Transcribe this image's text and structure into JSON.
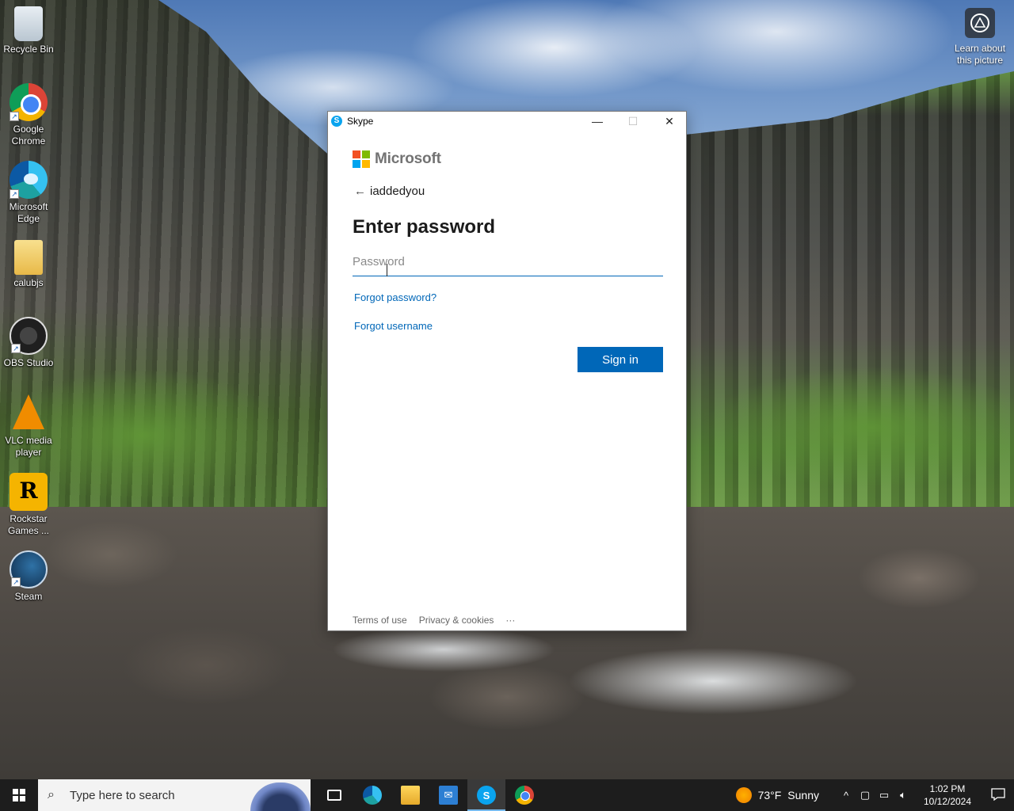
{
  "desktop": {
    "icons": [
      {
        "label": "Recycle Bin",
        "icon": "recycle-bin-icon"
      },
      {
        "label": "Google Chrome",
        "icon": "chrome-icon"
      },
      {
        "label": "Microsoft Edge",
        "icon": "edge-icon"
      },
      {
        "label": "calubjs",
        "icon": "folder-icon"
      },
      {
        "label": "OBS Studio",
        "icon": "obs-icon"
      },
      {
        "label": "VLC media player",
        "icon": "vlc-icon"
      },
      {
        "label": "Rockstar Games ...",
        "icon": "rockstar-icon"
      },
      {
        "label": "Steam",
        "icon": "steam-icon"
      }
    ],
    "learn_about": "Learn about this picture"
  },
  "window": {
    "title": "Skype",
    "app_icon_letter": "S",
    "controls": {
      "minimize": "—",
      "maximize": "☐",
      "close": "✕"
    },
    "brand": "Microsoft",
    "identity": "iaddedyou",
    "heading": "Enter password",
    "password_placeholder": "Password",
    "forgot_password": "Forgot password?",
    "forgot_username": "Forgot username",
    "sign_in": "Sign in",
    "footer": {
      "terms": "Terms of use",
      "privacy": "Privacy & cookies",
      "more": "···"
    }
  },
  "taskbar": {
    "search_placeholder": "Type here to search",
    "apps": [
      {
        "name": "task-view",
        "active": false
      },
      {
        "name": "edge",
        "active": false
      },
      {
        "name": "file-explorer",
        "active": false
      },
      {
        "name": "mail",
        "active": false
      },
      {
        "name": "skype",
        "active": true
      },
      {
        "name": "chrome",
        "active": false
      }
    ],
    "weather": {
      "temp": "73°F",
      "condition": "Sunny"
    },
    "clock": {
      "time": "1:02 PM",
      "date": "10/12/2024"
    }
  },
  "colors": {
    "accent": "#0067b8",
    "taskbar": "#1d1d1d",
    "skype": "#0aa4ef"
  }
}
